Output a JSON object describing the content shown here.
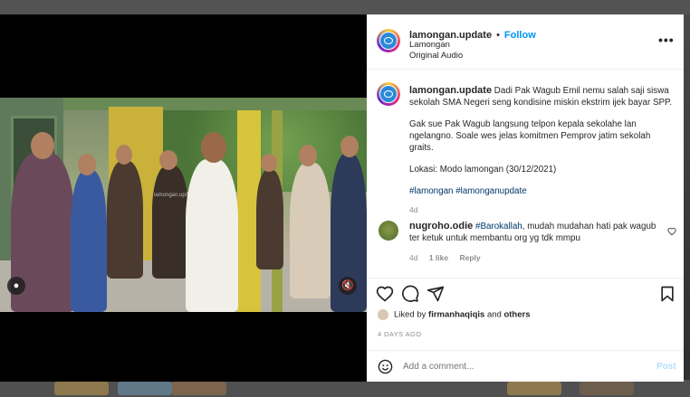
{
  "post": {
    "username": "lamongan.update",
    "follow_label": "Follow",
    "location": "Lamongan",
    "audio": "Original Audio",
    "more_icon": "more-horizontal-icon"
  },
  "caption": {
    "username": "lamongan.update",
    "paragraphs": [
      "Dadi Pak Wagub Emil nemu salah saji siswa sekolah SMA Negeri seng kondisine miskin ekstrim ijek bayar SPP.",
      "Gak sue Pak Wagub langsung telpon kepala sekolahe lan ngelangno. Soale wes jelas komitmen Pemprov jatim sekolah graits.",
      "Lokasi: Modo lamongan (30/12/2021)"
    ],
    "hashtags": "#lamongan #lamonganupdate",
    "age": "4d"
  },
  "comment": {
    "username": "nugroho.odie",
    "tag": "#Barokallah",
    "text": ", mudah mudahan hati pak wagub ter ketuk untuk membantu org yg tdk mmpu",
    "age": "4d",
    "likes": "1 like",
    "reply_label": "Reply"
  },
  "likes": {
    "prefix": "Liked by",
    "user": "firmanhaqiqis",
    "conj": "and",
    "others": "others"
  },
  "date": "4 DAYS AGO",
  "add_comment": {
    "placeholder": "Add a comment...",
    "post_label": "Post"
  },
  "video": {
    "watermark": "lamongan.update"
  },
  "colors": {
    "accent": "#0095f6",
    "hashtag": "#00376b",
    "muted": "#8e8e8e"
  }
}
